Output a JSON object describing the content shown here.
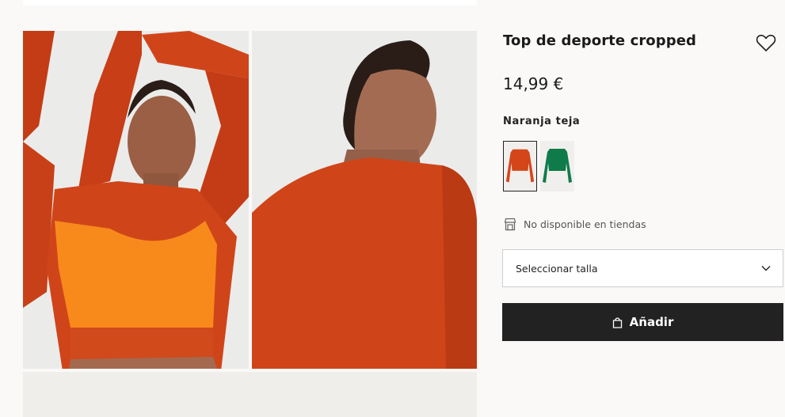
{
  "product": {
    "title": "Top de deporte cropped",
    "price": "14,99 €",
    "color_name": "Naranja teja",
    "availability": "No disponible en tiendas"
  },
  "swatches": [
    {
      "name": "orange",
      "color": "#d4461a",
      "selected": true
    },
    {
      "name": "green",
      "color": "#0f7a4a",
      "selected": false
    }
  ],
  "size_select": {
    "label": "Seleccionar talla"
  },
  "add_button": {
    "label": "Añadir"
  },
  "icons": {
    "favorite": "heart-icon",
    "store": "store-icon",
    "dropdown": "chevron-down-icon",
    "bag": "bag-icon"
  },
  "colors": {
    "button_bg": "#222222",
    "page_bg": "#faf9f8",
    "garment_rust": "#d4461a",
    "garment_orange": "#f88a1c",
    "garment_green": "#0f7a4a"
  }
}
